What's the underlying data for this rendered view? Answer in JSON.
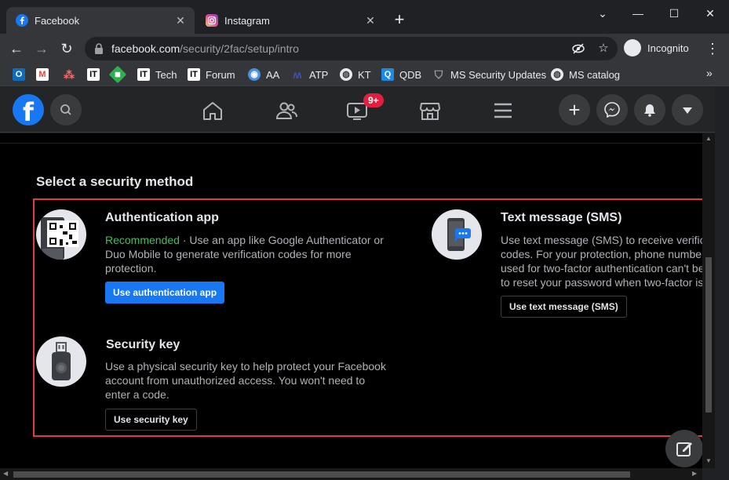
{
  "tabs": [
    {
      "label": "Facebook",
      "active": true,
      "icon": "facebook-favicon"
    },
    {
      "label": "Instagram",
      "active": false,
      "icon": "instagram-favicon"
    }
  ],
  "toolbar": {
    "url_host": "facebook.com",
    "url_path": "/security/2fac/setup/intro",
    "incognito_label": "Incognito"
  },
  "bookmarks": [
    {
      "label": "",
      "icon": "outlook-icon",
      "color": "#0f6cbd"
    },
    {
      "label": "",
      "icon": "gmail-icon",
      "color": "#ea4335"
    },
    {
      "label": "",
      "icon": "asana-icon",
      "color": "#f06a6a"
    },
    {
      "label": "",
      "icon": "it-icon",
      "color": "#ffffff"
    },
    {
      "label": "",
      "icon": "feedly-icon",
      "color": "#2bb24c"
    },
    {
      "label": "Tech",
      "icon": "it-icon",
      "color": "#ffffff"
    },
    {
      "label": "Forum",
      "icon": "it-icon",
      "color": "#ffffff"
    },
    {
      "label": "AA",
      "icon": "eye-icon",
      "color": "#4a90e2"
    },
    {
      "label": "ATP",
      "icon": "atp-icon",
      "color": "#3f51b5"
    },
    {
      "label": "KT",
      "icon": "globe-icon",
      "color": "#e8eaed"
    },
    {
      "label": "QDB",
      "icon": "q-icon",
      "color": "#1e88e5"
    },
    {
      "label": "MS Security Updates",
      "icon": "shield-icon",
      "color": "#9aa0a6"
    },
    {
      "label": "MS catalog",
      "icon": "globe-icon",
      "color": "#e8eaed"
    }
  ],
  "fb": {
    "badge": "9+",
    "colors": {
      "brand": "#1877f2",
      "recommended": "#45bd62",
      "highlight_box": "#e53b3b"
    }
  },
  "page": {
    "section_title": "Select a security method",
    "methods": {
      "auth_app": {
        "title": "Authentication app",
        "recommended": "Recommended",
        "desc_rest": " · Use an app like Google Authenticator or Duo Mobile to generate verification codes for more protection.",
        "button": "Use authentication app"
      },
      "sms": {
        "title": "Text message (SMS)",
        "desc_lines": [
          "Use text message (SMS) to receive verific",
          "codes. For your protection, phone number",
          "used for two-factor authentication can't be",
          "to reset your password when two-factor is"
        ],
        "button": "Use text message (SMS)"
      },
      "security_key": {
        "title": "Security key",
        "desc": "Use a physical security key to help protect your Facebook account from unauthorized access. You won't need to enter a code.",
        "button": "Use security key"
      }
    }
  }
}
